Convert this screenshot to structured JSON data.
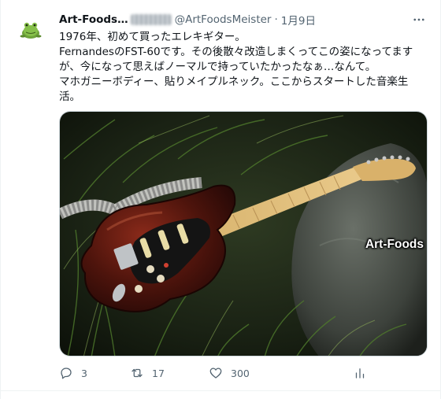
{
  "author": {
    "display_name": "Art-Foods…",
    "handle": "@ArtFoodsMeister",
    "separator": "·",
    "date": "1月9日"
  },
  "tweet": {
    "lines": [
      "1976年、初めて買ったエレキギター。",
      "FernandesのFST-60です。その後散々改造しまくってこの姿になってます",
      "が、今になって思えばノーマルで持っていたかったなぁ…なんて。",
      "マホガニーボディー、貼りメイプルネック。ここからスタートした音楽生",
      "活。"
    ]
  },
  "media": {
    "watermark": "Art-Foods"
  },
  "actions": {
    "reply_count": "3",
    "retweet_count": "17",
    "like_count": "300"
  },
  "icons": {
    "avatar": "frog-avatar",
    "more": "more-icon",
    "reply": "reply-icon",
    "retweet": "retweet-icon",
    "like": "heart-icon",
    "views": "views-icon"
  },
  "colors": {
    "text": "#0f1419",
    "secondary": "#536471",
    "border": "#cfd9de"
  }
}
